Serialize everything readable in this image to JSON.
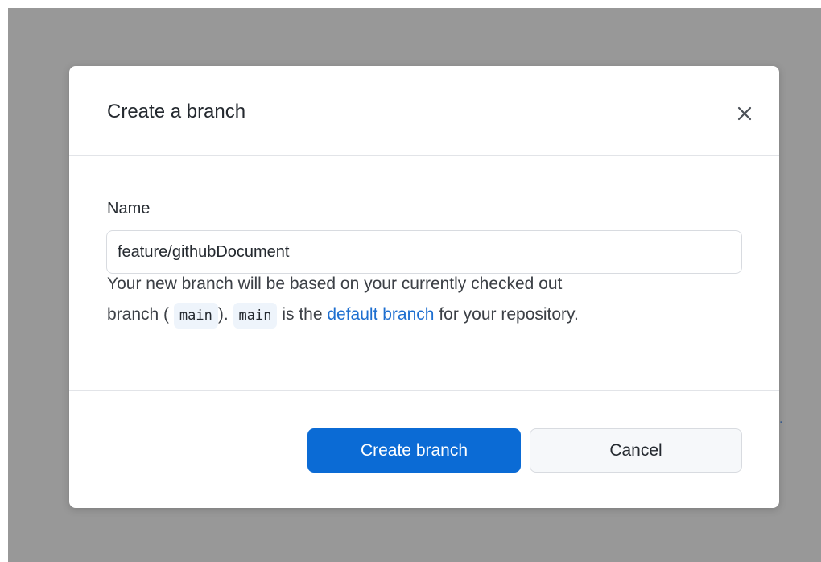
{
  "background": {
    "overlay_color": "#989898",
    "partial_text": "."
  },
  "dialog": {
    "title": "Create a branch",
    "close_icon": "close-icon",
    "name_field": {
      "label": "Name",
      "value": "feature/githubDocument"
    },
    "description": {
      "line1": "Your new branch will be based on your currently checked out",
      "line2_prefix": "branch (",
      "current_branch": "main",
      "line2_mid1": ").",
      "default_branch": "main",
      "line2_mid2": "is the",
      "link_text": "default branch",
      "line2_suffix": "for your repository."
    },
    "buttons": {
      "create_label": "Create branch",
      "cancel_label": "Cancel"
    }
  },
  "colors": {
    "primary": "#0b6bd5",
    "link": "#1e6fd0"
  }
}
